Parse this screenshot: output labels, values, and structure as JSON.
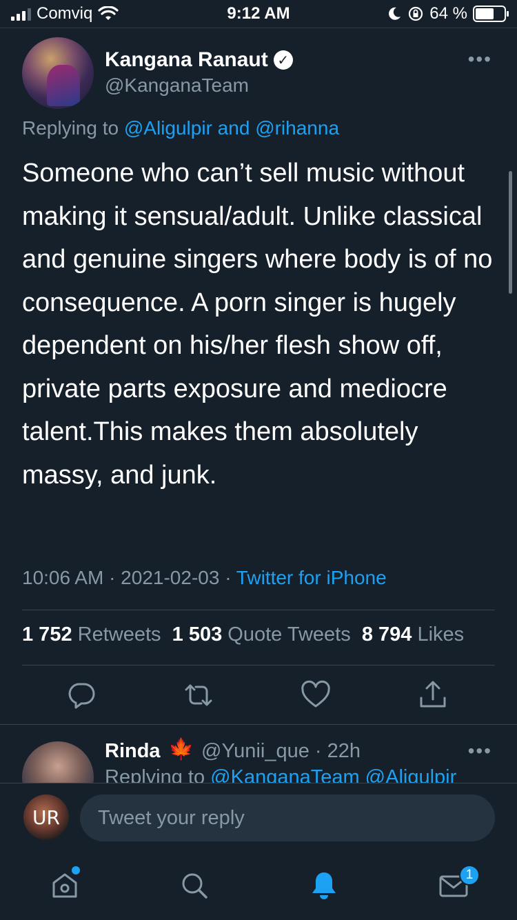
{
  "status_bar": {
    "carrier": "Comviq",
    "time": "9:12 AM",
    "battery_percent": "64 %",
    "battery_level": 0.64
  },
  "tweet": {
    "author_name": "Kangana Ranaut",
    "author_handle": "@KanganaTeam",
    "more": "•••",
    "replying_prefix": "Replying to ",
    "replying_user1": "@Aligulpir",
    "replying_and": " and ",
    "replying_user2": "@rihanna",
    "text": "Someone who can’t sell music without making it sensual/adult. Unlike classical and genuine singers where body is of no consequence. A porn singer is hugely dependent on his/her flesh show off, private parts exposure and mediocre talent.This makes them absolutely massy, and junk.",
    "timestamp": "10:06 AM · 2021-02-03 · ",
    "source": "Twitter for iPhone",
    "retweets_count": "1 752",
    "retweets_label": " Retweets",
    "quotes_count": "1 503",
    "quotes_label": " Quote Tweets",
    "likes_count": "8 794",
    "likes_label": " Likes"
  },
  "actions": {
    "icons": [
      "reply-icon",
      "retweet-icon",
      "like-icon",
      "share-icon"
    ]
  },
  "reply": {
    "name": "Rinda",
    "emoji": "🍁",
    "handle_time": "@Yunii_que · 22h",
    "more": "•••",
    "replying_prefix": "Replying to ",
    "replying_users": "@KanganaTeam @Aligulpir"
  },
  "compose": {
    "avatar_text": "UR",
    "placeholder": "Tweet your reply"
  },
  "tabbar": {
    "icons": [
      "home-icon",
      "search-icon",
      "notifications-icon",
      "messages-icon"
    ],
    "messages_badge": "1"
  },
  "colors": {
    "background": "#15202b",
    "accent": "#1da1f2",
    "secondary_text": "#8899a6"
  }
}
